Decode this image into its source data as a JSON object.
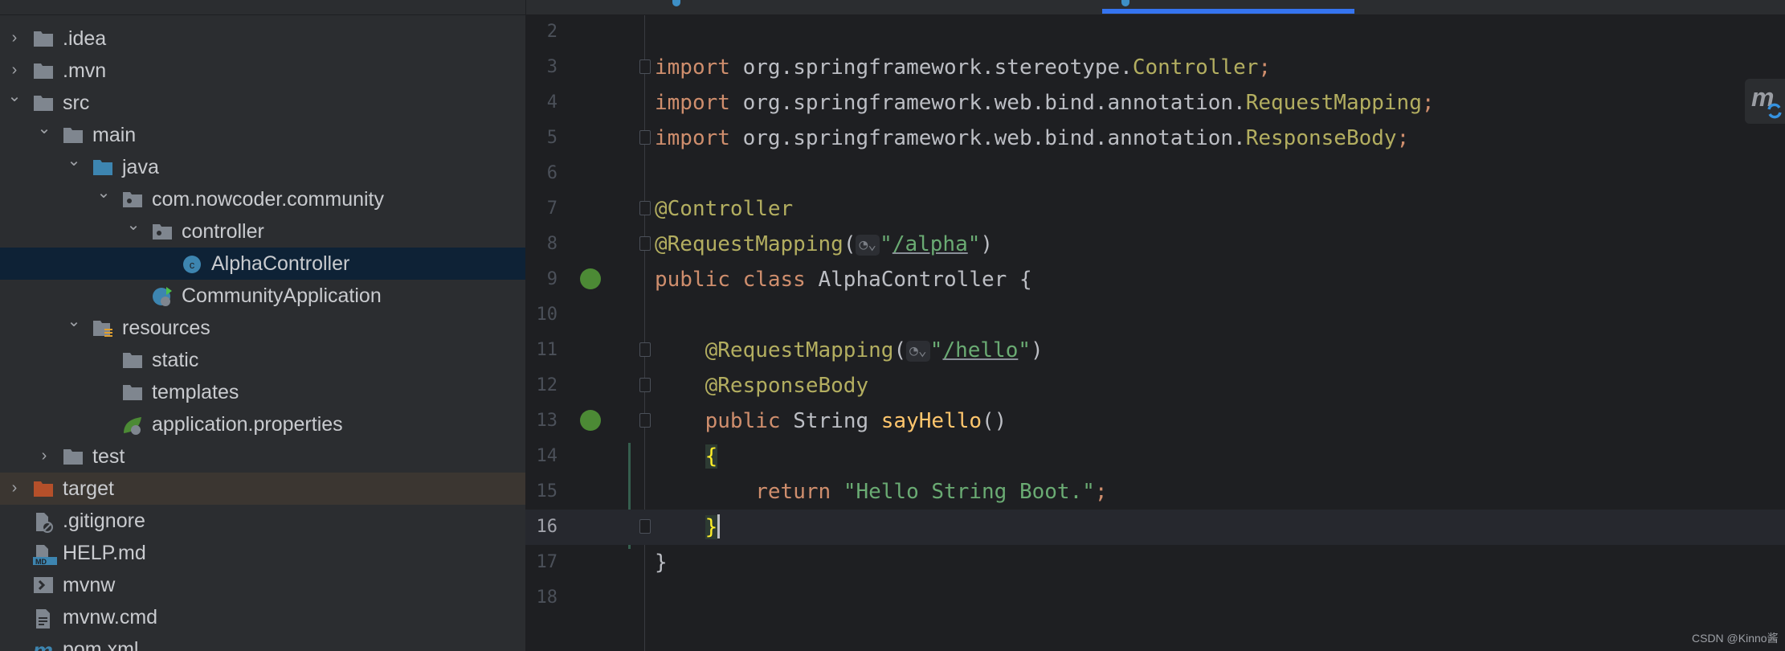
{
  "colors": {
    "accent": "#3574f0",
    "keyword": "#cf8e6d",
    "annotation": "#b3ae60",
    "string": "#6aab73",
    "method": "#ffc66d",
    "selection": "#0e2236",
    "excluded": "#3b3631"
  },
  "project_tree": [
    {
      "label": ".idea",
      "depth": 0,
      "expander": "collapsed",
      "icon": "folder-icon"
    },
    {
      "label": ".mvn",
      "depth": 0,
      "expander": "collapsed",
      "icon": "folder-icon"
    },
    {
      "label": "src",
      "depth": 0,
      "expander": "expanded",
      "icon": "folder-icon"
    },
    {
      "label": "main",
      "depth": 1,
      "expander": "expanded",
      "icon": "folder-icon"
    },
    {
      "label": "java",
      "depth": 2,
      "expander": "expanded",
      "icon": "source-folder-icon"
    },
    {
      "label": "com.nowcoder.community",
      "depth": 3,
      "expander": "expanded",
      "icon": "package-icon"
    },
    {
      "label": "controller",
      "depth": 4,
      "expander": "expanded",
      "icon": "package-icon"
    },
    {
      "label": "AlphaController",
      "depth": 5,
      "expander": "none",
      "icon": "class-icon",
      "selected": true
    },
    {
      "label": "CommunityApplication",
      "depth": 4,
      "expander": "none",
      "icon": "spring-boot-class-icon"
    },
    {
      "label": "resources",
      "depth": 2,
      "expander": "expanded",
      "icon": "resources-folder-icon"
    },
    {
      "label": "static",
      "depth": 3,
      "expander": "none",
      "icon": "folder-icon"
    },
    {
      "label": "templates",
      "depth": 3,
      "expander": "none",
      "icon": "folder-icon"
    },
    {
      "label": "application.properties",
      "depth": 3,
      "expander": "none",
      "icon": "spring-properties-icon"
    },
    {
      "label": "test",
      "depth": 1,
      "expander": "collapsed",
      "icon": "folder-icon"
    },
    {
      "label": "target",
      "depth": 0,
      "expander": "collapsed",
      "icon": "excluded-folder-icon",
      "excluded": true
    },
    {
      "label": ".gitignore",
      "depth": 0,
      "expander": "none",
      "icon": "gitignore-file-icon"
    },
    {
      "label": "HELP.md",
      "depth": 0,
      "expander": "none",
      "icon": "markdown-file-icon"
    },
    {
      "label": "mvnw",
      "depth": 0,
      "expander": "none",
      "icon": "shell-script-icon"
    },
    {
      "label": "mvnw.cmd",
      "depth": 0,
      "expander": "none",
      "icon": "text-file-icon"
    },
    {
      "label": "pom.xml",
      "depth": 0,
      "expander": "none",
      "icon": "maven-icon"
    }
  ],
  "editor": {
    "lines": [
      {
        "n": "2",
        "tokens": []
      },
      {
        "n": "3",
        "fold": true,
        "tokens": [
          [
            "kw",
            "import "
          ],
          [
            "id",
            "org.springframework.stereotype."
          ],
          [
            "ann",
            "Controller"
          ],
          [
            "kw",
            ";"
          ]
        ]
      },
      {
        "n": "4",
        "tokens": [
          [
            "kw",
            "import "
          ],
          [
            "id",
            "org.springframework.web.bind.annotation."
          ],
          [
            "ann",
            "RequestMapping"
          ],
          [
            "kw",
            ";"
          ]
        ]
      },
      {
        "n": "5",
        "fold": true,
        "tokens": [
          [
            "kw",
            "import "
          ],
          [
            "id",
            "org.springframework.web.bind.annotation."
          ],
          [
            "ann",
            "ResponseBody"
          ],
          [
            "kw",
            ";"
          ]
        ]
      },
      {
        "n": "6",
        "tokens": []
      },
      {
        "n": "7",
        "fold": true,
        "tokens": [
          [
            "ann",
            "@Controller"
          ]
        ]
      },
      {
        "n": "8",
        "fold": true,
        "tokens": [
          [
            "ann",
            "@RequestMapping"
          ],
          [
            "id",
            "("
          ],
          [
            "inlay",
            "◔⌄"
          ],
          [
            "str",
            "\""
          ],
          [
            "url",
            "/alpha"
          ],
          [
            "str",
            "\""
          ],
          [
            "id",
            ")"
          ]
        ]
      },
      {
        "n": "9",
        "gutter_icon": "spring-bean-icon",
        "tokens": [
          [
            "kw",
            "public class "
          ],
          [
            "id",
            "AlphaController {"
          ]
        ]
      },
      {
        "n": "10",
        "tokens": []
      },
      {
        "n": "11",
        "fold": true,
        "tokens": [
          [
            "id",
            "    "
          ],
          [
            "ann",
            "@RequestMapping"
          ],
          [
            "id",
            "("
          ],
          [
            "inlay",
            "◔⌄"
          ],
          [
            "str",
            "\""
          ],
          [
            "url",
            "/hello"
          ],
          [
            "str",
            "\""
          ],
          [
            "id",
            ")"
          ]
        ]
      },
      {
        "n": "12",
        "fold": true,
        "tokens": [
          [
            "id",
            "    "
          ],
          [
            "ann",
            "@ResponseBody"
          ]
        ]
      },
      {
        "n": "13",
        "fold": true,
        "gutter_icon": "spring-web-endpoint-icon",
        "tokens": [
          [
            "id",
            "    "
          ],
          [
            "kw",
            "public "
          ],
          [
            "id",
            "String "
          ],
          [
            "fn",
            "sayHello"
          ],
          [
            "id",
            "()"
          ]
        ]
      },
      {
        "n": "14",
        "tokens": [
          [
            "id",
            "    "
          ],
          [
            "brace",
            "{"
          ]
        ]
      },
      {
        "n": "15",
        "tokens": [
          [
            "id",
            "        "
          ],
          [
            "kw",
            "return "
          ],
          [
            "str",
            "\"Hello String Boot.\""
          ],
          [
            "kw",
            ";"
          ]
        ]
      },
      {
        "n": "16",
        "fold": true,
        "current": true,
        "tokens": [
          [
            "id",
            "    "
          ],
          [
            "brace",
            "}"
          ],
          [
            "caret",
            ""
          ]
        ]
      },
      {
        "n": "17",
        "tokens": [
          [
            "id",
            "}"
          ]
        ]
      },
      {
        "n": "18",
        "tokens": []
      }
    ]
  },
  "maven_button": {
    "icon": "maven-reload-icon",
    "label": "m"
  },
  "watermark": "CSDN @Kinno酱"
}
